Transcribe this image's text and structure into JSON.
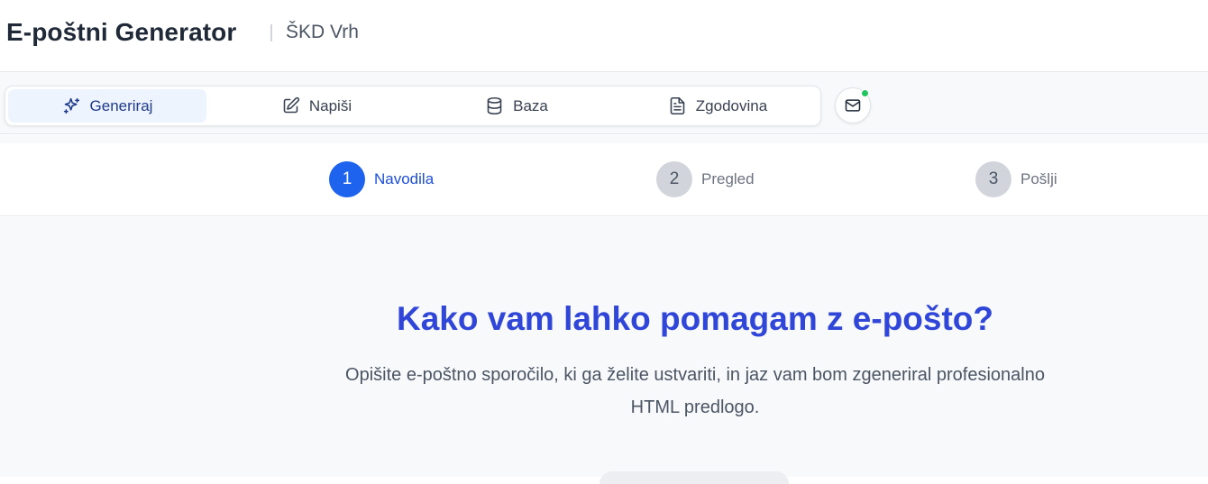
{
  "header": {
    "app_title": "E-poštni Generator",
    "organization": "ŠKD Vrh"
  },
  "nav": {
    "tabs": [
      {
        "label": "Generiraj",
        "icon": "sparkles-icon",
        "active": true
      },
      {
        "label": "Napiši",
        "icon": "edit-icon",
        "active": false
      },
      {
        "label": "Baza",
        "icon": "database-icon",
        "active": false
      },
      {
        "label": "Zgodovina",
        "icon": "file-text-icon",
        "active": false
      }
    ],
    "mail_button": {
      "icon": "mail-icon",
      "status": "online",
      "status_color": "#22c55e"
    }
  },
  "steps": [
    {
      "number": "1",
      "label": "Navodila",
      "active": true
    },
    {
      "number": "2",
      "label": "Pregled",
      "active": false
    },
    {
      "number": "3",
      "label": "Pošlji",
      "active": false
    }
  ],
  "main": {
    "headline": "Kako vam lahko pomagam z e-pošto?",
    "description": "Opišite e-poštno sporočilo, ki ga želite ustvariti, in jaz vam bom zgeneriral profesionalno HTML predlogo."
  },
  "colors": {
    "accent": "#1d63ed",
    "headline": "#3046d8",
    "active_tab_bg": "#eef4fd"
  }
}
